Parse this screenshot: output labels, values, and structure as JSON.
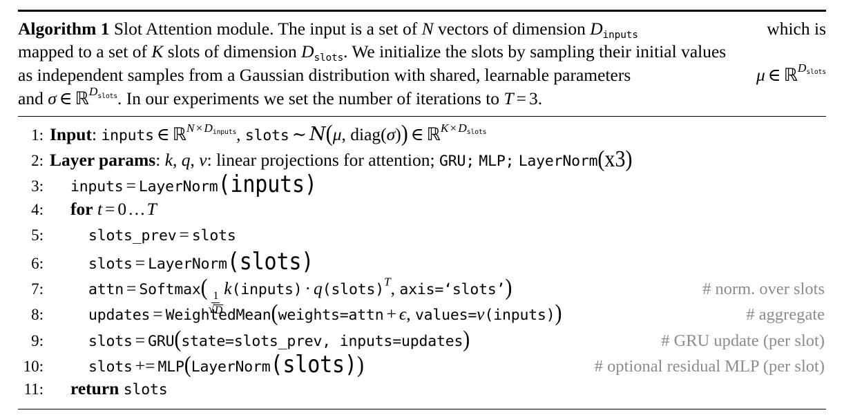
{
  "figure": {
    "label": "Algorithm 1",
    "title": "Slot Attention module.",
    "caption_text": "The input is a set of N vectors of dimension D_inputs which is mapped to a set of K slots of dimension D_slots. We initialize the slots by sampling their initial values as independent samples from a Gaussian distribution with shared, learnable parameters mu in R^{D_slots} and sigma in R^{D_slots}. In our experiments we set the number of iterations to T = 3.",
    "caption_segments": {
      "l1_a": "Slot Attention module. The input is a set of",
      "l1_N": "N",
      "l1_b": "vectors of dimension",
      "l1_D": "D",
      "l1_Dsub": "inputs",
      "l1_c": "which is",
      "l2_a": "mapped to a set of",
      "l2_K": "K",
      "l2_b": "slots of dimension",
      "l2_D": "D",
      "l2_Dsub": "slots",
      "l2_c": ". We initialize the slots by sampling their initial values",
      "l3_a": "as independent samples from a Gaussian distribution with shared, learnable parameters",
      "l3_mu": "μ",
      "l3_in": "∈",
      "l3_R": "ℝ",
      "l3_D": "D",
      "l3_Dsub": "slots",
      "l4_and": "and",
      "l4_sigma": "σ",
      "l4_in": "∈",
      "l4_R": "ℝ",
      "l4_D": "D",
      "l4_Dsub": "slots",
      "l4_b": ". In our experiments we set the number of iterations to",
      "l4_T": "T",
      "l4_eq": "=",
      "l4_val": "3."
    }
  },
  "lines": [
    {
      "number": "1:",
      "keyword": "Input",
      "colon": ":",
      "code_plain": "inputs ∈ R^{N×D_inputs}, slots ~ N(μ, diag(σ)) ∈ R^{K×D_slots}",
      "tokens": {
        "inputs": "inputs",
        "in1": "∈",
        "R1": "ℝ",
        "N": "N",
        "times1": "×",
        "D1": "D",
        "D1sub": "inputs",
        "comma": ",",
        "slots": "slots",
        "sim": "∼",
        "scrN": "N",
        "mu": "μ",
        "comma2": ",",
        "diag": "diag",
        "sigma": "σ",
        "in2": "∈",
        "R2": "ℝ",
        "K": "K",
        "times2": "×",
        "D2": "D",
        "D2sub": "slots"
      },
      "comment": ""
    },
    {
      "number": "2:",
      "keyword": "Layer params",
      "colon": ":",
      "code_plain": "k, q, v: linear projections for attention; GRU; MLP; LayerNorm(x3)",
      "tokens": {
        "k": "k",
        "comma1": ",",
        "q": "q",
        "comma2": ",",
        "v": "v",
        "text": ": linear projections for attention;",
        "gru": "GRU;",
        "mlp": "MLP;",
        "layernorm": "LayerNorm",
        "x3": "(x3)"
      },
      "comment": ""
    },
    {
      "number": "3:",
      "code_plain": "inputs = LayerNorm(inputs)",
      "tokens": {
        "lhs": "inputs",
        "eq": "=",
        "fn": "LayerNorm",
        "arg": "(inputs)"
      },
      "comment": ""
    },
    {
      "number": "4:",
      "keyword": "for",
      "code_plain": "t = 0 ... T",
      "tokens": {
        "t": "t",
        "eq": "=",
        "zero": "0",
        "dots": "…",
        "T": "T"
      },
      "comment": ""
    },
    {
      "number": "5:",
      "code_plain": "slots_prev = slots",
      "tokens": {
        "lhs": "slots_prev",
        "eq": "=",
        "rhs": "slots"
      },
      "comment": ""
    },
    {
      "number": "6:",
      "code_plain": "slots = LayerNorm(slots)",
      "tokens": {
        "lhs": "slots",
        "eq": "=",
        "fn": "LayerNorm",
        "arg": "(slots)"
      },
      "comment": ""
    },
    {
      "number": "7:",
      "code_plain": "attn = Softmax( 1/sqrt(D) k(inputs) · q(slots)^T, axis='slots')",
      "tokens": {
        "lhs": "attn",
        "eq": "=",
        "fn": "Softmax",
        "paren_open": "(",
        "frac_num": "1",
        "frac_den_rad": "D",
        "k": "k",
        "k_arg": "(inputs)",
        "cdot": "·",
        "q": "q",
        "q_arg": "(slots)",
        "sup_T": "T",
        "comma": ",",
        "axis": "axis=‘slots’",
        "paren_close": ")"
      },
      "comment": "# norm. over slots"
    },
    {
      "number": "8:",
      "code_plain": "updates = WeightedMean(weights=attn + ϵ, values=v(inputs))",
      "tokens": {
        "lhs": "updates",
        "eq": "=",
        "fn": "WeightedMean",
        "paren_open": "(",
        "weights": "weights=attn",
        "plus": "+",
        "eps": "ϵ",
        "comma": ",",
        "values": "values=",
        "v": "v",
        "v_arg": "(inputs)",
        "paren_close": ")"
      },
      "comment": "# aggregate"
    },
    {
      "number": "9:",
      "code_plain": "slots = GRU(state=slots_prev, inputs=updates)",
      "tokens": {
        "lhs": "slots",
        "eq": "=",
        "fn": "GRU",
        "paren_open": "(",
        "args": "state=slots_prev, inputs=updates",
        "paren_close": ")"
      },
      "comment": "# GRU update (per slot)"
    },
    {
      "number": "10:",
      "code_plain": "slots += MLP(LayerNorm(slots))",
      "tokens": {
        "lhs": "slots",
        "pluseq": "+=",
        "fn": "MLP",
        "paren_open": "(",
        "inner": "LayerNorm",
        "inner_arg": "(slots)",
        "paren_close": ")"
      },
      "comment": "# optional residual MLP (per slot)"
    },
    {
      "number": "11:",
      "keyword": "return",
      "code_plain": "slots",
      "tokens": {
        "rhs": "slots"
      },
      "comment": ""
    }
  ],
  "colors": {
    "text": "#000000",
    "comment": "#8c8c8c",
    "rule": "#000000",
    "background": "#ffffff"
  }
}
